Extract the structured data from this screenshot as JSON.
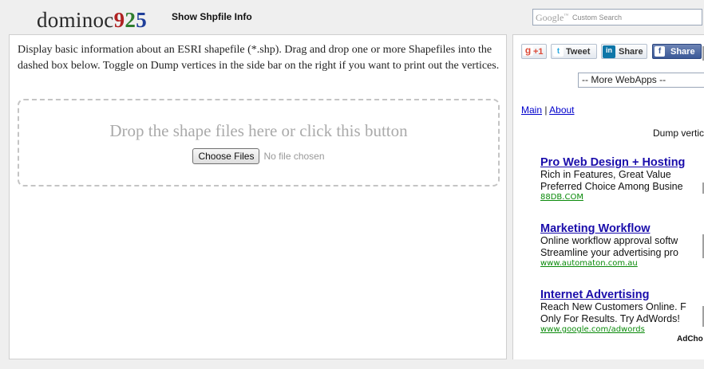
{
  "header": {
    "logo_text": "dominoc",
    "logo_digit1": "9",
    "logo_digit2": "2",
    "logo_digit3": "5",
    "app_title": "Show Shpfile Info",
    "search": {
      "brand": "Google",
      "placeholder": "Custom Search"
    }
  },
  "main": {
    "description": "Display basic information about an ESRI shapefile (*.shp). Drag and drop one or more Shapefiles into the dashed box below. Toggle on Dump vertices in the side bar on the right if you want to print out the vertices.",
    "dropzone_text": "Drop the shape files here or click this button",
    "choose_button": "Choose Files",
    "no_file_text": "No file chosen"
  },
  "sidebar": {
    "share_buttons": {
      "gplus": "+1",
      "tweet": "Tweet",
      "linkedin": "Share",
      "facebook": "Share"
    },
    "webapps_select": "-- More WebApps --",
    "nav": {
      "main": "Main",
      "separator": "|",
      "about": "About"
    },
    "dump_label": "Dump vertic",
    "ads": [
      {
        "title": "Pro Web Design + Hosting",
        "line1": "Rich in Features, Great Value",
        "line2": "Preferred Choice Among Busine",
        "url": "88DB.COM"
      },
      {
        "title": "Marketing Workflow",
        "line1": "Online workflow approval softw",
        "line2": "Streamline your advertising pro",
        "url": "www.automaton.com.au"
      },
      {
        "title": "Internet Advertising",
        "line1": "Reach New Customers Online. F",
        "line2": "Only For Results. Try AdWords!",
        "url": "www.google.com/adwords"
      }
    ],
    "adchoices": "AdCho"
  },
  "colors": {
    "link": "#0000cc",
    "ad_title": "#1a0dab",
    "ad_url": "#0a8a0a",
    "background": "#efefef"
  }
}
